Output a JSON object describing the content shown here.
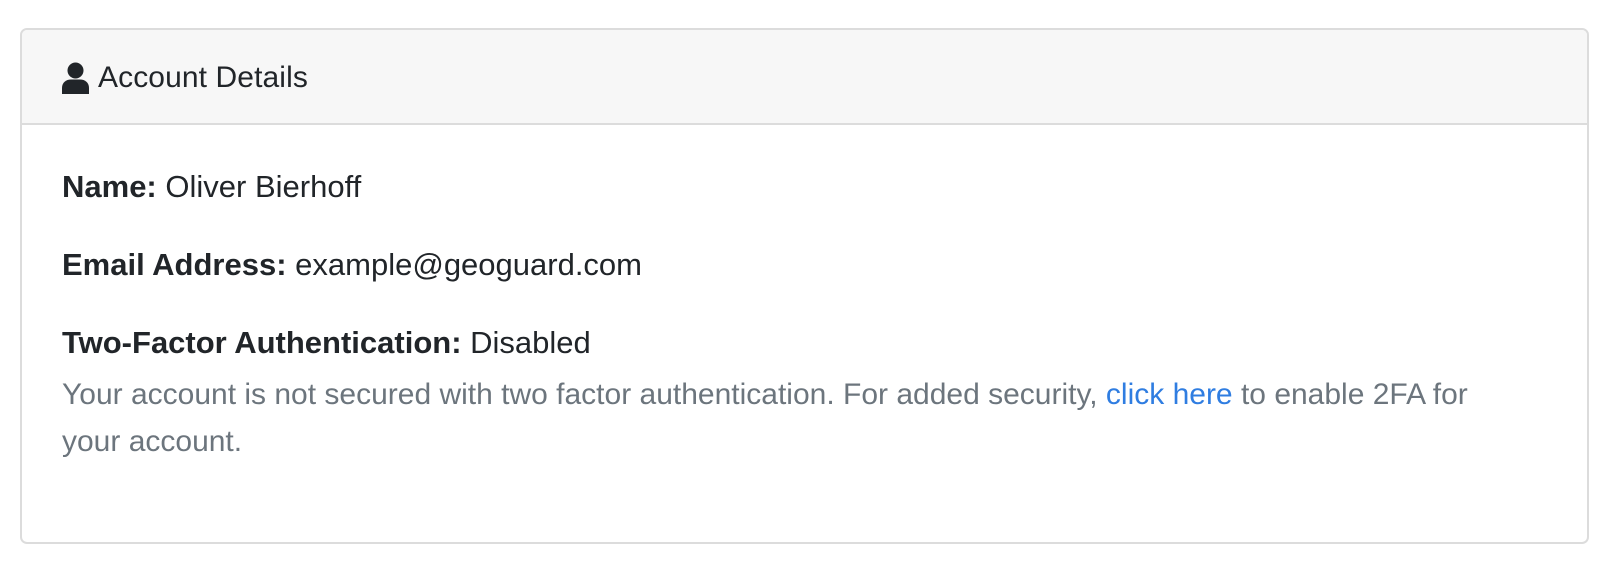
{
  "card": {
    "icon": "user-icon",
    "title": "Account Details"
  },
  "fields": {
    "name_label": "Name:",
    "name_value": "Oliver Bierhoff",
    "email_label": "Email Address:",
    "email_value": "example@geoguard.com",
    "twofa_label": "Two-Factor Authentication:",
    "twofa_value": "Disabled"
  },
  "twofa_help": {
    "text_before": "Your account is not secured with two factor authentication. For added security, ",
    "link_text": "click here",
    "text_after": " to enable 2FA for your account."
  },
  "colors": {
    "link": "#2f7de1",
    "muted_text": "#6c757d",
    "header_bg": "#f7f7f7"
  }
}
